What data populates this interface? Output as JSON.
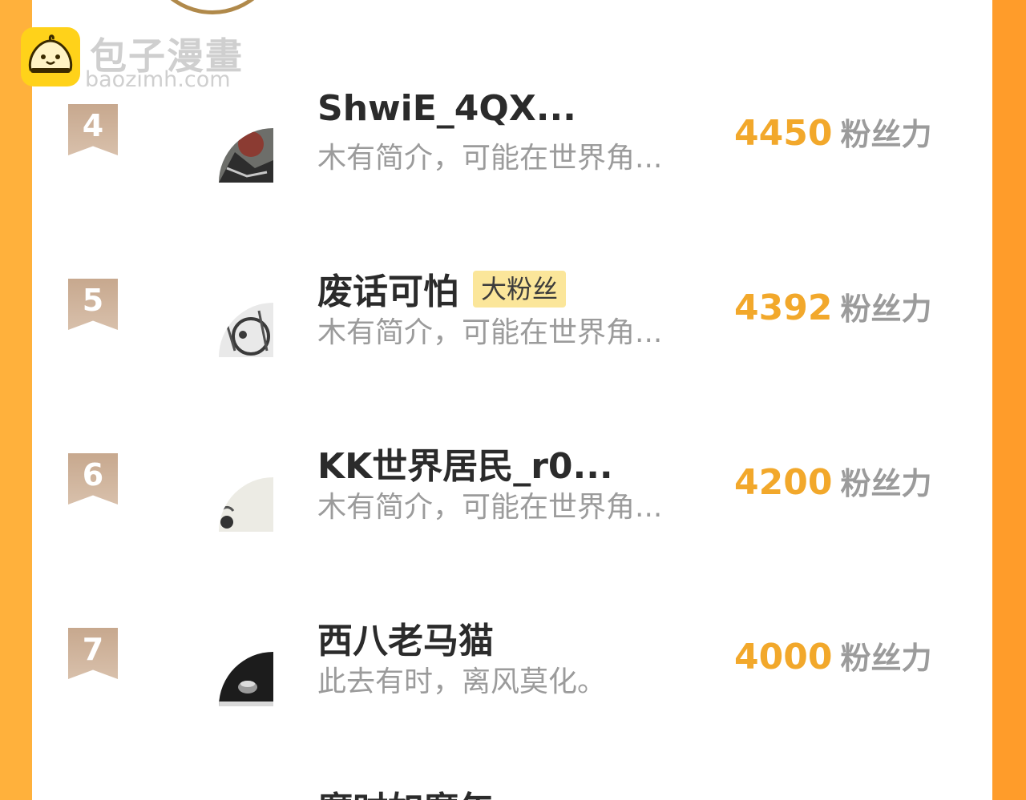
{
  "logo": {
    "title": "包子漫畫",
    "domain": "baozimh.com"
  },
  "rows": [
    {
      "rank": "4",
      "name": "ShwiE_4QX...",
      "badge": "",
      "bio": "木有简介，可能在世界角...",
      "score": "4450",
      "unit": "粉丝力"
    },
    {
      "rank": "5",
      "name": "废话可怕",
      "badge": "大粉丝",
      "bio": "木有简介，可能在世界角...",
      "score": "4392",
      "unit": "粉丝力"
    },
    {
      "rank": "6",
      "name": "KK世界居民_r0...",
      "badge": "",
      "bio": "木有简介，可能在世界角...",
      "score": "4200",
      "unit": "粉丝力"
    },
    {
      "rank": "7",
      "name": "西八老马猫",
      "badge": "",
      "bio": "此去有时，离风莫化。",
      "score": "4000",
      "unit": "粉丝力"
    }
  ],
  "next_row_name_partial": "魔时如魔年",
  "colors": {
    "accent_orange": "#f2a82b",
    "rank_ribbon": "#c7a88e",
    "badge_bg": "#fbe69a",
    "side_left": "#ffb13c",
    "side_right": "#ff9c2a"
  }
}
